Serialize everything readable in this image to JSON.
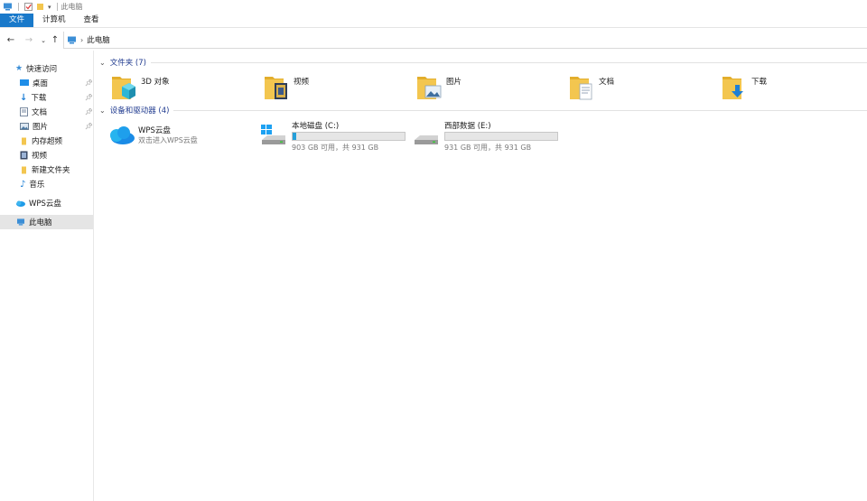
{
  "window": {
    "title": "此电脑"
  },
  "ribbon": {
    "tabs": [
      "文件",
      "计算机",
      "查看"
    ]
  },
  "address": {
    "path": "此电脑"
  },
  "sidebar": {
    "quick_access": "快速访问",
    "items": [
      {
        "label": "桌面",
        "pinned": true
      },
      {
        "label": "下载",
        "pinned": true
      },
      {
        "label": "文档",
        "pinned": true
      },
      {
        "label": "图片",
        "pinned": true
      },
      {
        "label": "内存超频",
        "pinned": false
      },
      {
        "label": "视频",
        "pinned": false
      },
      {
        "label": "新建文件夹",
        "pinned": false
      },
      {
        "label": "音乐",
        "pinned": false
      }
    ],
    "wps_cloud": "WPS云盘",
    "this_pc": "此电脑"
  },
  "folders": {
    "header": "文件夹 (7)",
    "items": [
      {
        "label": "3D 对象",
        "icon": "3d-objects-folder-icon"
      },
      {
        "label": "视频",
        "icon": "videos-folder-icon"
      },
      {
        "label": "图片",
        "icon": "pictures-folder-icon"
      },
      {
        "label": "文档",
        "icon": "documents-folder-icon"
      },
      {
        "label": "下载",
        "icon": "downloads-folder-icon"
      }
    ]
  },
  "devices": {
    "header": "设备和驱动器 (4)",
    "wps": {
      "name": "WPS云盘",
      "sub": "双击进入WPS云盘"
    },
    "drives": [
      {
        "name": "本地磁盘 (C:)",
        "usage": "903 GB 可用，共 931 GB",
        "used_fraction": 0.03
      },
      {
        "name": "西部数据 (E:)",
        "usage": "931 GB 可用，共 931 GB",
        "used_fraction": 0.0
      }
    ]
  },
  "colors": {
    "accent": "#1979ca",
    "bar_fill": "#26a0da",
    "folder_yellow": "#f3c64f"
  }
}
